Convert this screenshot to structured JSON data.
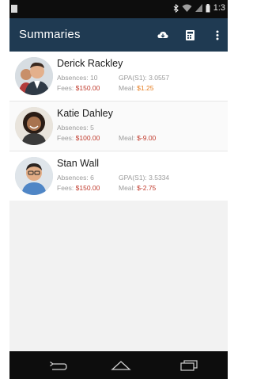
{
  "status_bar": {
    "time": "1:3"
  },
  "app_bar": {
    "title": "Summaries",
    "actions": [
      "cloud-download-icon",
      "calculator-icon",
      "overflow-menu-icon"
    ]
  },
  "students": [
    {
      "name": "Derick Rackley",
      "absences_label": "Absences:",
      "absences": "10",
      "gpa_label": "GPA(S1):",
      "gpa": "3.0557",
      "fees_label": "Fees:",
      "fees": "$150.00",
      "meal_label": "Meal:",
      "meal": "$1.25",
      "meal_color": "#e67e22",
      "avatar_icon": "student-avatar-1"
    },
    {
      "name": "Katie Dahley",
      "absences_label": "Absences:",
      "absences": "5",
      "gpa_label": "",
      "gpa": "",
      "fees_label": "Fees:",
      "fees": "$100.00",
      "meal_label": "Meal:",
      "meal": "$-9.00",
      "meal_color": "#c0392b",
      "avatar_icon": "student-avatar-2"
    },
    {
      "name": "Stan Wall",
      "absences_label": "Absences:",
      "absences": "6",
      "gpa_label": "GPA(S1):",
      "gpa": "3.5334",
      "fees_label": "Fees:",
      "fees": "$150.00",
      "meal_label": "Meal:",
      "meal": "$-2.75",
      "meal_color": "#c0392b",
      "avatar_icon": "student-avatar-3"
    }
  ],
  "colors": {
    "app_bar": "#1f3a52",
    "status_bar": "#0d0d0d",
    "money_red": "#c0392b",
    "money_orange": "#e67e22"
  },
  "nav_bar": {
    "buttons": [
      "back-icon",
      "home-icon",
      "recents-icon"
    ]
  }
}
